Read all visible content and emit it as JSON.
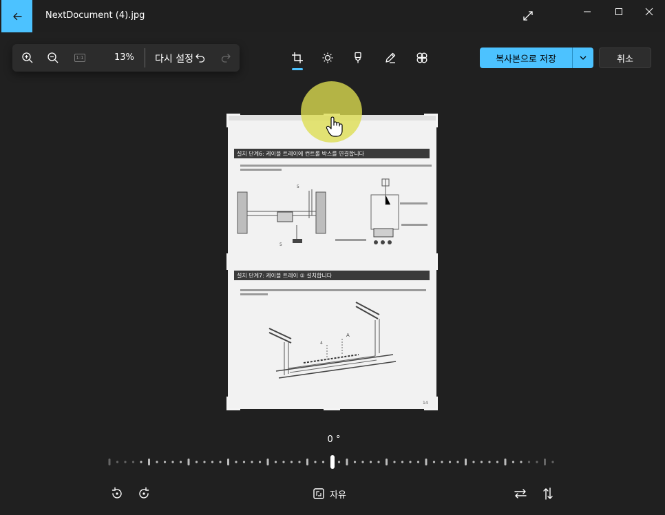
{
  "window": {
    "title": "NextDocument (4).jpg"
  },
  "toolbar": {
    "zoom_percent": "13%",
    "actual_size_label": "1:1",
    "reset_label": "다시 설정",
    "save_copy_label": "복사본으로 저장",
    "cancel_label": "취소"
  },
  "document": {
    "section1_heading": "설치 단계6: 케이블 트레이에 컨트롤 박스를 연결합니다",
    "section2_heading": "설치 단계7: 케이블 트레이 ② 설치합니다",
    "page_number": "14"
  },
  "rotation": {
    "angle_label": "0 °"
  },
  "aspect": {
    "label": "자유"
  },
  "colors": {
    "accent": "#4cc2ff",
    "background": "#202020",
    "cursor_highlight": "#dede50"
  }
}
